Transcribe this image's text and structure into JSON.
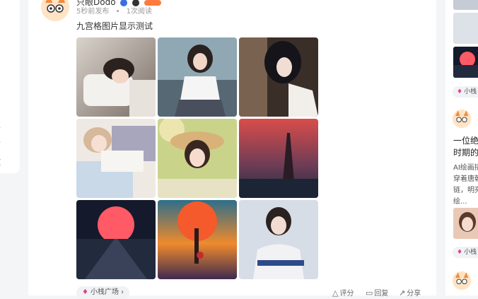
{
  "left_menu": {
    "items": [
      "复",
      "分",
      "核"
    ]
  },
  "post": {
    "author": "只眼Dodo",
    "time": "5秒前发布",
    "views": "1次阅读",
    "text": "九宫格图片显示测试",
    "images": [
      {
        "name": "girl-lying-on-pillow-image",
        "colors": [
          "#cfc8c0",
          "#6a5a52"
        ]
      },
      {
        "name": "girl-in-school-uniform-image",
        "colors": [
          "#8aa7b2",
          "#3c4b57"
        ]
      },
      {
        "name": "girl-by-window-image",
        "colors": [
          "#6b5546",
          "#2a2220"
        ]
      },
      {
        "name": "girl-reading-book-image",
        "colors": [
          "#eee7e1",
          "#b8b1c3"
        ]
      },
      {
        "name": "girl-in-straw-hat-image",
        "colors": [
          "#f0d7a0",
          "#9ab25e"
        ]
      },
      {
        "name": "crimson-dusk-landscape-image",
        "colors": [
          "#c24a4a",
          "#283247"
        ]
      },
      {
        "name": "red-moon-road-image",
        "colors": [
          "#ff5a66",
          "#141a2b"
        ]
      },
      {
        "name": "autumn-tree-sunset-image",
        "colors": [
          "#f08a2c",
          "#3f2a4f"
        ]
      },
      {
        "name": "girl-in-sweater-image",
        "colors": [
          "#d8dfe8",
          "#2d4a8a"
        ]
      }
    ],
    "topic": "小栈广场",
    "actions": {
      "rate": "评分",
      "reply": "回复",
      "share": "分享"
    }
  },
  "right_panel": {
    "tag_label": "小栈",
    "card_title_lines": [
      "一位绝",
      "时期的"
    ],
    "card_desc_lines": [
      "AI绘画描",
      "穿着唐朝",
      "链，明亮",
      "绘..."
    ]
  },
  "colors": {
    "accent_pink": "#e0408f",
    "badge_blue": "#3b6fe3",
    "level_orange": "#ff7a3d"
  }
}
